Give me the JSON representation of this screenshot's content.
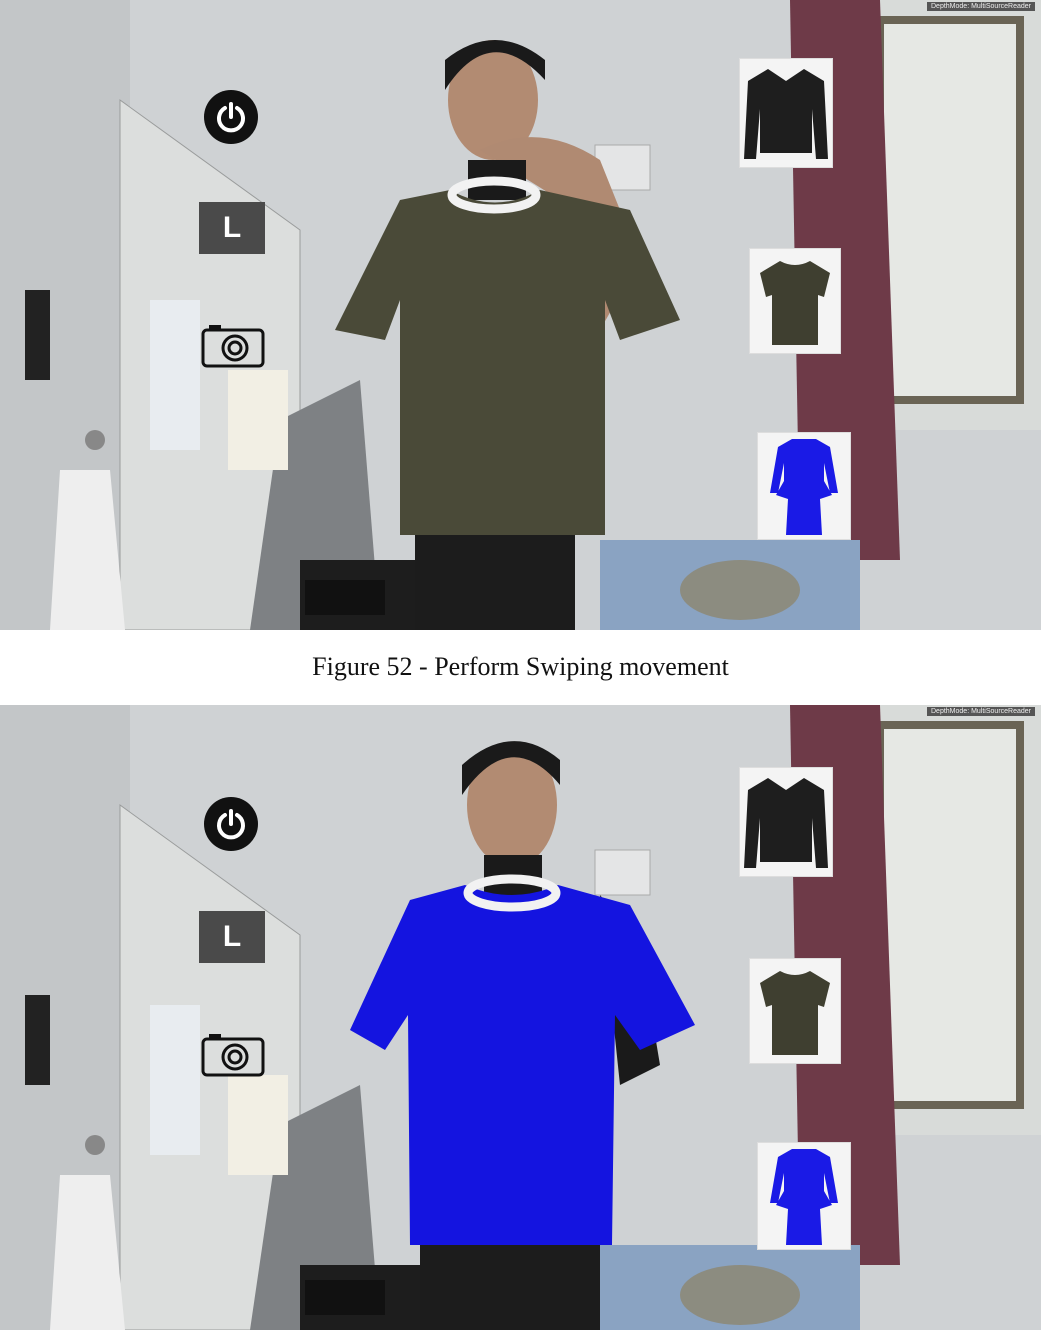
{
  "caption": "Figure 52 - Perform Swiping movement",
  "frames": [
    {
      "depth_mode": "DepthMode: MultiSourceReader",
      "size_label": "L",
      "tryon_shirt_color": "#4a4a38",
      "icons": [
        "power-icon",
        "size-button",
        "camera-icon"
      ]
    },
    {
      "depth_mode": "DepthMode: MultiSourceReader",
      "size_label": "L",
      "tryon_shirt_color": "#1414e0",
      "icons": [
        "power-icon",
        "size-button",
        "camera-icon"
      ]
    }
  ],
  "clothing_catalog": [
    {
      "name": "black-sweater",
      "color": "#1e1e1e"
    },
    {
      "name": "olive-tshirt",
      "color": "#3f3f30"
    },
    {
      "name": "blue-peplum-dress",
      "color": "#1a1ae6"
    }
  ]
}
